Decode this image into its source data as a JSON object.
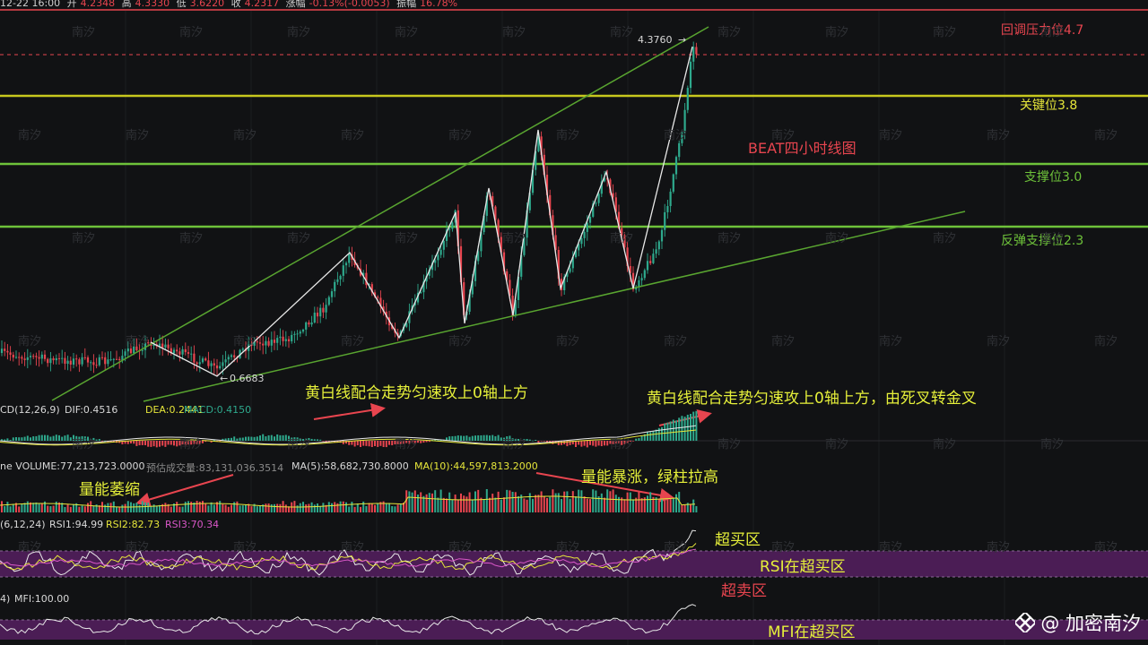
{
  "header": {
    "datetime": "12-22 16:00",
    "open_label": "开",
    "open": "4.2348",
    "high_label": "高",
    "high": "4.3330",
    "low_label": "低",
    "low": "3.6220",
    "close_label": "收",
    "close": "4.2317",
    "change_label": "涨幅",
    "change": "-0.13%(-0.0053)",
    "amplitude_label": "振幅",
    "amplitude": "16.78%"
  },
  "levels": {
    "resistance": "回调压力位4.7",
    "key": "关键位3.8",
    "support": "支撑位3.0",
    "rebound_support": "反弹支撑位2.3"
  },
  "colors": {
    "up": "#2ea98d",
    "down": "#e8454f",
    "yellow_line": "#c8c81e",
    "green_line": "#6ec23a",
    "annotation": "#e6f03a",
    "oversold_zone": "#4b1d55"
  },
  "chart_title": "BEAT四小时线图",
  "price_labels": {
    "high_point": "4.3760",
    "low_point": "0.6683"
  },
  "macd": {
    "label": "CD(12,26,9)",
    "dif": "DIF:0.4516",
    "dea": "DEA:0.2441",
    "macd": "MACD:0.4150"
  },
  "volume": {
    "label": "ne VOLUME:77,213,723.0000",
    "estimated": "预估成交量:83,131,036.3514",
    "ma5": "MA(5):58,682,730.8000",
    "ma10": "MA(10):44,597,813.2000"
  },
  "rsi": {
    "label": "(6,12,24)",
    "rsi1": "RSI1:94.99",
    "rsi2": "RSI2:82.73",
    "rsi3": "RSI3:70.34"
  },
  "mfi": {
    "label": "4)",
    "value": "MFI:100.00"
  },
  "annotations": {
    "macd_left": "黄白线配合走势匀速攻上0轴上方",
    "macd_right": "黄白线配合走势匀速攻上0轴上方，由死叉转金叉",
    "volume_left": "量能萎缩",
    "volume_right": "量能暴涨，绿柱拉高",
    "overbought": "超买区",
    "rsi_overbought": "RSI在超买区",
    "oversold": "超卖区",
    "mfi_overbought": "MFI在超买区"
  },
  "watermark": "南汐",
  "logo": {
    "text": "@ 加密南汐",
    "icon": "binance-diamond-icon"
  }
}
